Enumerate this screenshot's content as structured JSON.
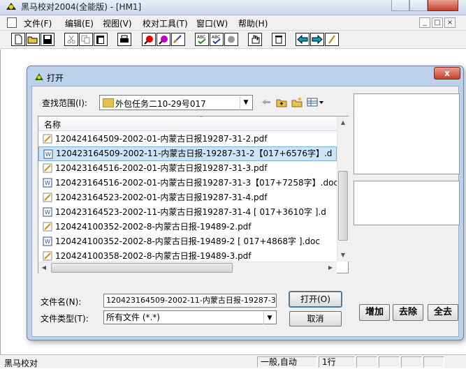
{
  "app": {
    "title": "黑马校对2004(全能版) - [HM1]",
    "menus": [
      "文件(F)",
      "编辑(E)",
      "视图(V)",
      "校对工具(T)",
      "窗口(W)",
      "帮助(H)"
    ],
    "mdi_buttons": [
      "_",
      "□",
      "×"
    ]
  },
  "dialog": {
    "title": "打开",
    "close_label": "x",
    "lookin_label": "查找范围(I):",
    "lookin_value": "外包任务二10-29号017",
    "column_header": "名称",
    "files": [
      {
        "name": "120424164509-2002-01-内蒙古日报19287-31-2.pdf",
        "type": "pdf"
      },
      {
        "name": "120423164509-2002-11-内蒙古日报-19287-31-2【017+6576字】.d",
        "type": "doc",
        "selected": true
      },
      {
        "name": "120423164516-2002-01-内蒙古日报19287-31-3.pdf",
        "type": "pdf"
      },
      {
        "name": "120423164516-2002-01-内蒙古日报19287-31-3【017+7258字】.doc",
        "type": "doc"
      },
      {
        "name": "120423164523-2002-01-内蒙古日报19287-31-4.pdf",
        "type": "pdf"
      },
      {
        "name": "120423164523-2002-11-内蒙古日报19287-31-4 [ 017+3610字 ].d",
        "type": "doc"
      },
      {
        "name": "120424100352-2002-8-内蒙古日报-19489-2.pdf",
        "type": "pdf"
      },
      {
        "name": "120424100352-2002-8-内蒙古日报-19489-2 [ 017+4868字 ].doc",
        "type": "doc"
      },
      {
        "name": "120424100358-2002-8-内蒙古日报-19489-3.pdf",
        "type": "pdf"
      }
    ],
    "filename_label": "文件名(N):",
    "filename_value": "120423164509-2002-11-内蒙古日报-19287-3",
    "filetype_label": "文件类型(T):",
    "filetype_value": "所有文件 (*.*)",
    "open_label": "打开(O)",
    "cancel_label": "取消",
    "add_label": "增加",
    "remove_label": "去除",
    "all_label": "全去"
  },
  "status": {
    "left": "黑马校对",
    "mode": "一般,自动",
    "line": "1行"
  }
}
